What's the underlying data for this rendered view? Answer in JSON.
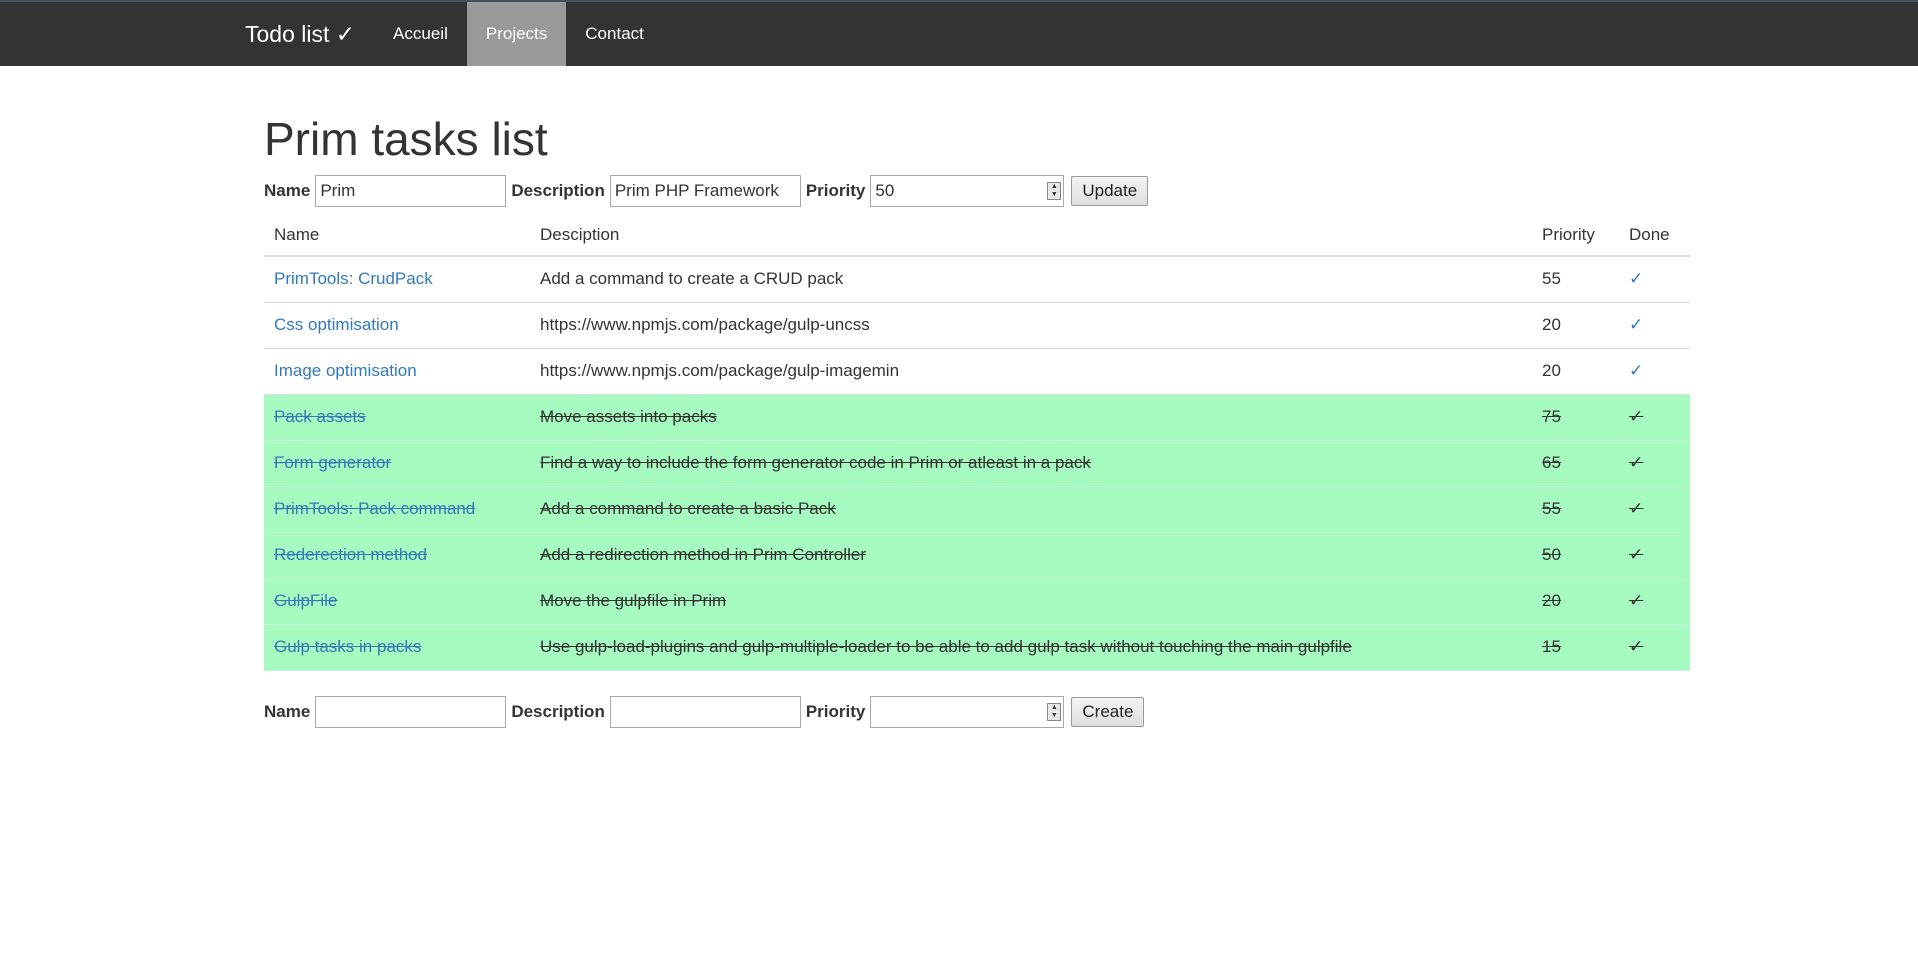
{
  "nav": {
    "brand": "Todo list ✓",
    "links": [
      {
        "label": "Accueil",
        "active": false
      },
      {
        "label": "Projects",
        "active": true
      },
      {
        "label": "Contact",
        "active": false
      }
    ]
  },
  "page_title": "Prim tasks list",
  "edit_form": {
    "name_label": "Name",
    "name_value": "Prim",
    "description_label": "Description",
    "description_value": "Prim PHP Framework",
    "priority_label": "Priority",
    "priority_value": "50",
    "submit_label": "Update"
  },
  "table": {
    "headers": [
      "Name",
      "Desciption",
      "Priority",
      "Done"
    ],
    "rows": [
      {
        "name": "PrimTools: CrudPack",
        "description": "Add a command to create a CRUD pack",
        "priority": "55",
        "done_mark": "✓",
        "done": false
      },
      {
        "name": "Css optimisation",
        "description": "https://www.npmjs.com/package/gulp-uncss",
        "priority": "20",
        "done_mark": "✓",
        "done": false
      },
      {
        "name": "Image optimisation",
        "description": "https://www.npmjs.com/package/gulp-imagemin",
        "priority": "20",
        "done_mark": "✓",
        "done": false
      },
      {
        "name": "Pack assets",
        "description": "Move assets into packs",
        "priority": "75",
        "done_mark": "✓",
        "done": true
      },
      {
        "name": "Form generator",
        "description": "Find a way to include the form generator code in Prim or atleast in a pack",
        "priority": "65",
        "done_mark": "✓",
        "done": true
      },
      {
        "name": "PrimTools: Pack command",
        "description": "Add a command to create a basic Pack",
        "priority": "55",
        "done_mark": "✓",
        "done": true
      },
      {
        "name": "Rederection method",
        "description": "Add a redirection method in Prim Controller",
        "priority": "50",
        "done_mark": "✓",
        "done": true
      },
      {
        "name": "GulpFile",
        "description": "Move the gulpfile in Prim",
        "priority": "20",
        "done_mark": "✓",
        "done": true
      },
      {
        "name": "Gulp tasks in packs",
        "description": "Use gulp-load-plugins and gulp-multiple-loader to be able to add gulp task without touching the main gulpfile",
        "priority": "15",
        "done_mark": "✓",
        "done": true
      }
    ]
  },
  "create_form": {
    "name_label": "Name",
    "name_value": "",
    "description_label": "Description",
    "description_value": "",
    "priority_label": "Priority",
    "priority_value": "",
    "submit_label": "Create"
  },
  "colors": {
    "navbar_bg": "#333333",
    "nav_active_bg": "#999999",
    "done_row_bg": "#a6fbc0",
    "link": "#337ab7"
  }
}
